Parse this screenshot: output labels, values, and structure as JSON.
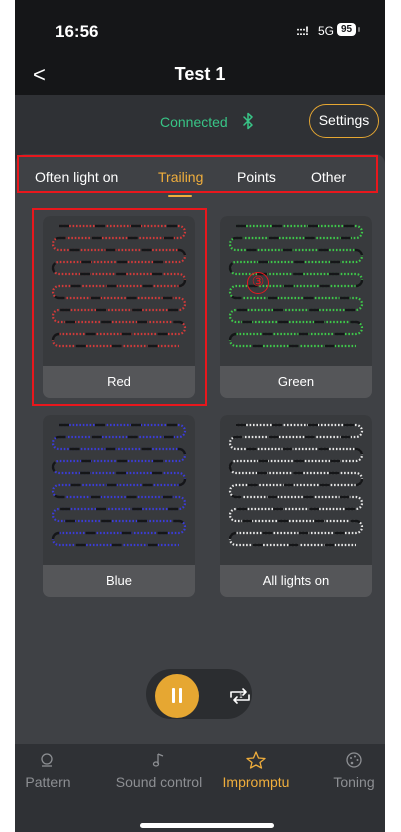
{
  "status_bar": {
    "time": "16:56",
    "signal": ":::!",
    "network": "5G",
    "battery": "95"
  },
  "header": {
    "back_label": "<",
    "title": "Test 1"
  },
  "connection": {
    "status": "Connected",
    "settings_label": "Settings"
  },
  "tabs": [
    {
      "label": "Often light on",
      "active": false
    },
    {
      "label": "Trailing",
      "active": true
    },
    {
      "label": "Points",
      "active": false
    },
    {
      "label": "Other",
      "active": false
    }
  ],
  "tiles": [
    {
      "label": "Red",
      "color": "#d23a3a"
    },
    {
      "label": "Green",
      "color": "#3ec94a"
    },
    {
      "label": "Blue",
      "color": "#3b3cd8"
    },
    {
      "label": "All lights on",
      "color": "#e8e8e8"
    }
  ],
  "annotation_marker": "③",
  "playback": {
    "pause_icon": "pause-icon",
    "loop_icon": "loop-once-icon",
    "loop_digit": "1"
  },
  "bottom_nav": [
    {
      "label": "Pattern",
      "icon": "pattern-icon",
      "active": false
    },
    {
      "label": "Sound control",
      "icon": "music-note-icon",
      "active": false
    },
    {
      "label": "Impromptu",
      "icon": "sparkle-star-icon",
      "active": true
    },
    {
      "label": "Toning",
      "icon": "palette-icon",
      "active": false
    }
  ],
  "colors": {
    "accent": "#f0ae3c",
    "connected": "#38c486",
    "annotation": "#e8171d",
    "background": "#2f3135"
  }
}
